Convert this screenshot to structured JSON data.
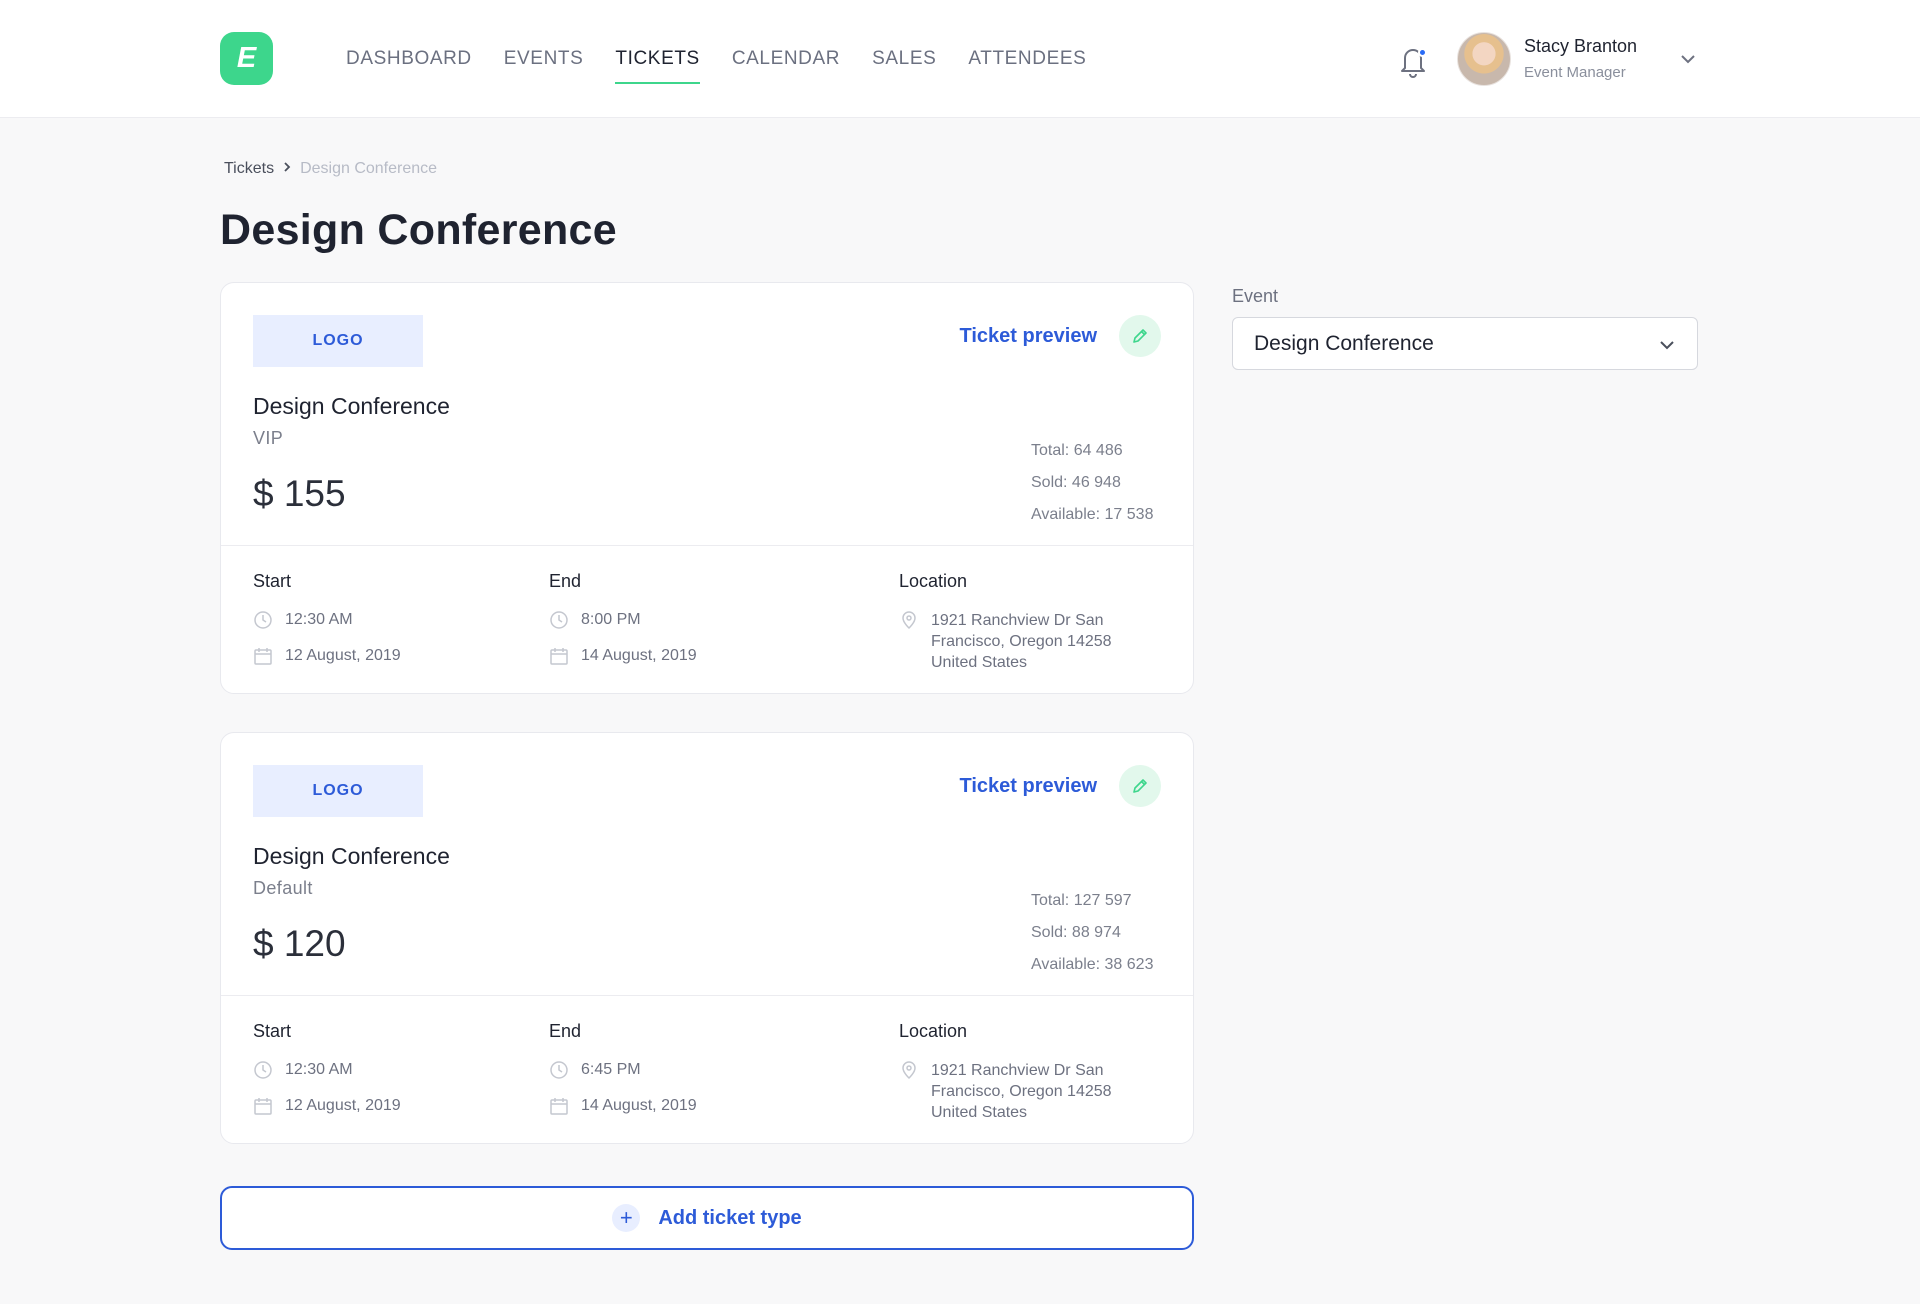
{
  "app": {
    "logo_letter": "E"
  },
  "nav": [
    {
      "label": "DASHBOARD",
      "active": false
    },
    {
      "label": "EVENTS",
      "active": false
    },
    {
      "label": "TICKETS",
      "active": true
    },
    {
      "label": "CALENDAR",
      "active": false
    },
    {
      "label": "SALES",
      "active": false
    },
    {
      "label": "ATTENDEES",
      "active": false
    }
  ],
  "user": {
    "name": "Stacy Branton",
    "role": "Event Manager"
  },
  "breadcrumb": {
    "parent": "Tickets",
    "current": "Design Conference"
  },
  "page": {
    "title": "Design Conference"
  },
  "tickets": [
    {
      "logo_label": "LOGO",
      "preview_label": "Ticket preview",
      "event_name": "Design Conference",
      "tier": "VIP",
      "price": "$ 155",
      "total": "Total: 64 486",
      "sold": "Sold: 46 948",
      "available": "Available: 17 538",
      "start_label": "Start",
      "start_time": "12:30 AM",
      "start_date": "12 August, 2019",
      "end_label": "End",
      "end_time": "8:00 PM",
      "end_date": "14 August, 2019",
      "location_label": "Location",
      "location": "1921 Ranchview Dr San Francisco, Oregon 14258 United States"
    },
    {
      "logo_label": "LOGO",
      "preview_label": "Ticket preview",
      "event_name": "Design Conference",
      "tier": "Default",
      "price": "$ 120",
      "total": "Total: 127 597",
      "sold": "Sold: 88 974",
      "available": "Available: 38 623",
      "start_label": "Start",
      "start_time": "12:30 AM",
      "start_date": "12 August, 2019",
      "end_label": "End",
      "end_time": "6:45 PM",
      "end_date": "14 August, 2019",
      "location_label": "Location",
      "location": "1921 Ranchview Dr San Francisco, Oregon 14258 United States"
    }
  ],
  "add_ticket": {
    "label": "Add ticket type",
    "icon": "plus-icon"
  },
  "event_filter": {
    "label": "Event",
    "value": "Design Conference"
  },
  "icons": {
    "bell": "bell-icon",
    "chevron": "chevron-down-icon",
    "edit": "pencil-icon",
    "clock": "clock-icon",
    "calendar": "calendar-icon",
    "location": "map-pin-icon"
  },
  "colors": {
    "accent_green": "#3dd68c",
    "accent_blue": "#2d5bd8",
    "notification_dot": "#2b6cf6"
  }
}
